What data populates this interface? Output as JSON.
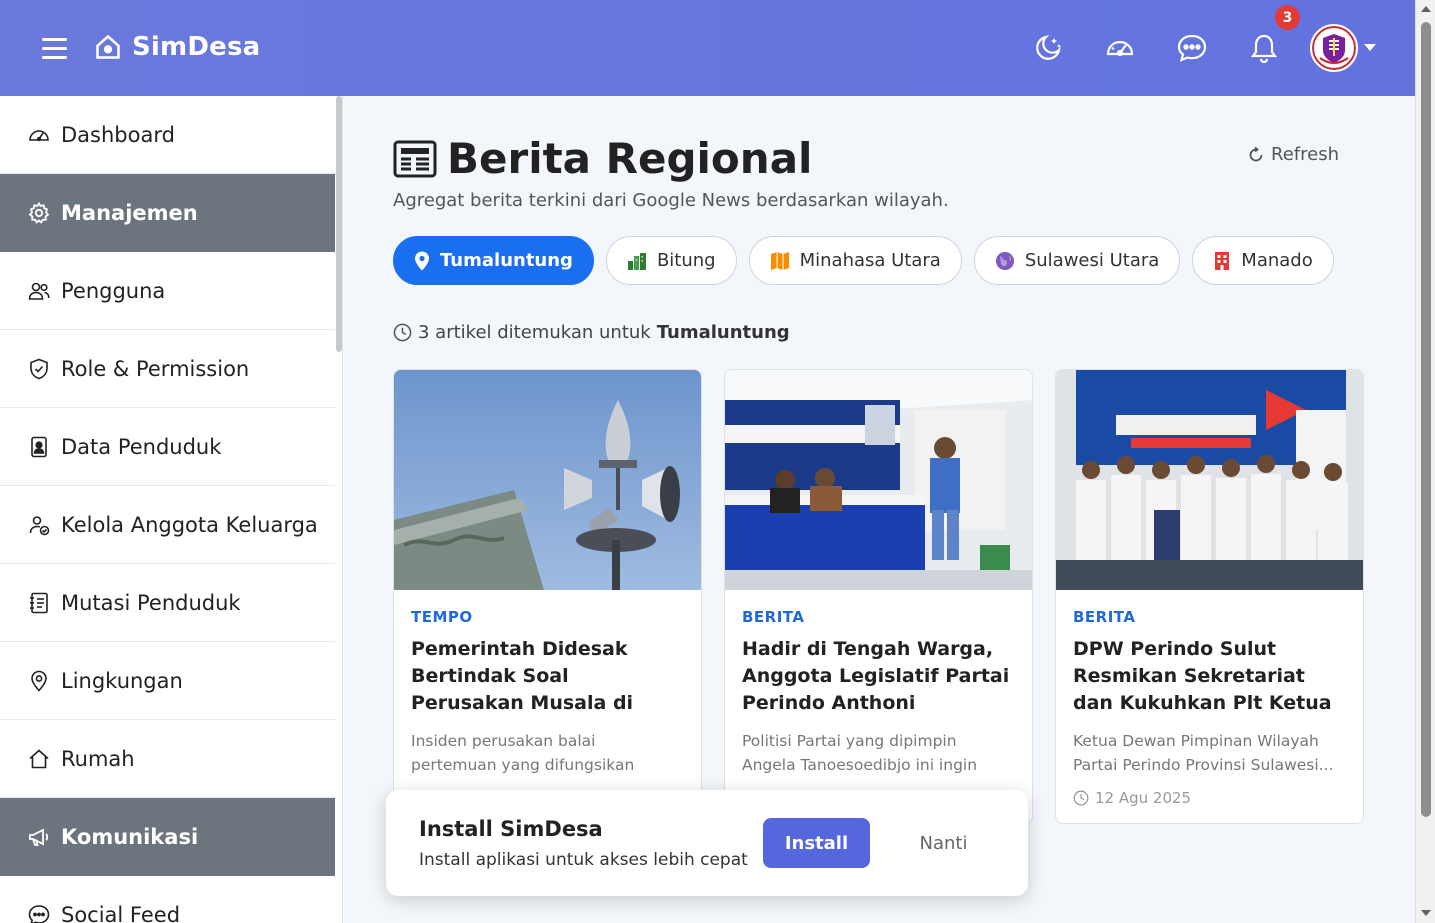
{
  "header": {
    "brand": "SimDesa",
    "notification_count": "3",
    "icons": [
      "menu-icon",
      "home-icon",
      "moon-stars-icon",
      "speedometer-icon",
      "chat-icon",
      "bell-icon"
    ]
  },
  "sidebar": {
    "items": [
      {
        "label": "Dashboard",
        "icon": "speedometer-icon"
      },
      {
        "label": "Manajemen",
        "icon": "gear-icon",
        "section": true
      },
      {
        "label": "Pengguna",
        "icon": "users-icon"
      },
      {
        "label": "Role & Permission",
        "icon": "shield-icon"
      },
      {
        "label": "Data Penduduk",
        "icon": "id-badge-icon"
      },
      {
        "label": "Kelola Anggota Keluarga",
        "icon": "user-check-icon"
      },
      {
        "label": "Mutasi Penduduk",
        "icon": "journal-icon"
      },
      {
        "label": "Lingkungan",
        "icon": "map-pin-icon"
      },
      {
        "label": "Rumah",
        "icon": "house-icon"
      },
      {
        "label": "Komunikasi",
        "icon": "megaphone-icon",
        "section": true
      },
      {
        "label": "Social Feed",
        "icon": "chat-dots-icon"
      }
    ]
  },
  "main": {
    "title": "Berita Regional",
    "subtitle": "Agregat berita terkini dari Google News berdasarkan wilayah.",
    "refresh_label": "Refresh",
    "tabs": [
      {
        "label": "Tumaluntung",
        "active": true
      },
      {
        "label": "Bitung"
      },
      {
        "label": "Minahasa Utara"
      },
      {
        "label": "Sulawesi Utara"
      },
      {
        "label": "Manado"
      }
    ],
    "count_prefix": "3 artikel ditemukan untuk",
    "count_region": "Tumaluntung",
    "articles": [
      {
        "source": "TEMPO",
        "title": "Pemerintah Didesak Bertindak Soal Perusakan Musala di Tumaluntung",
        "description": "Insiden perusakan balai pertemuan yang difungsikan sebagai musala ...",
        "date": ""
      },
      {
        "source": "BERITA",
        "title": "Hadir di Tengah Warga, Anggota Legislatif Partai Perindo Anthoni Pusung...",
        "description": "Politisi Partai yang dipimpin Angela Tanoesoedibjo ini ingin mendenga...",
        "date": ""
      },
      {
        "source": "BERITA",
        "title": "DPW Perindo Sulut Resmikan Sekretariat dan Kukuhkan Plt Ketua DPD Minahasa Utara :...",
        "description": "Ketua Dewan Pimpinan Wilayah Partai Perindo Provinsi Sulawesi...",
        "date": "12 Agu 2025"
      }
    ]
  },
  "install_prompt": {
    "title": "Install SimDesa",
    "subtitle": "Install aplikasi untuk akses lebih cepat",
    "install_label": "Install",
    "later_label": "Nanti"
  },
  "colors": {
    "header": "#6a79dc",
    "active_tab": "#1a6ef0",
    "section": "#6c757d",
    "install_button": "#5567dc"
  }
}
